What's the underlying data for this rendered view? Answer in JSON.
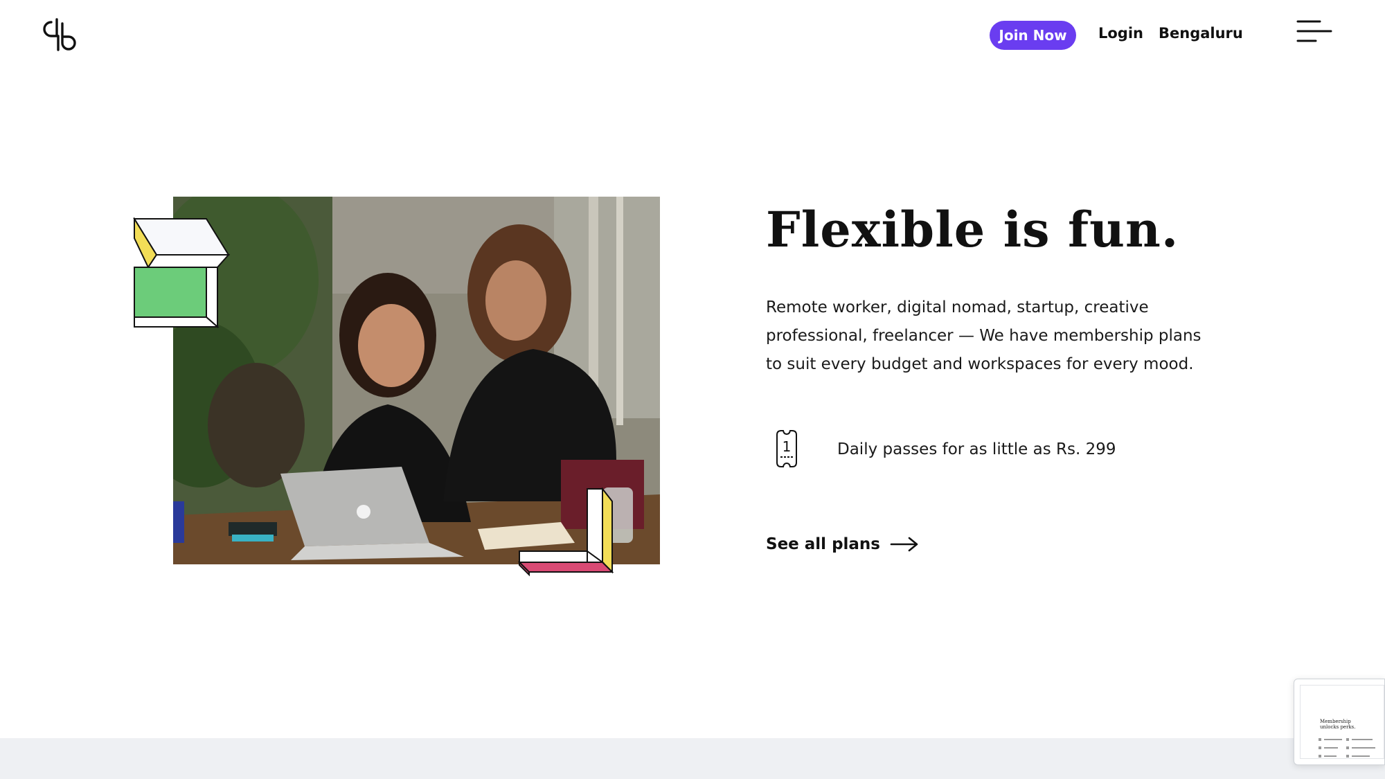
{
  "header": {
    "logo_icon": "ws-logo-icon",
    "join_label": "Join Now",
    "login_label": "Login",
    "city_label": "Bengaluru",
    "menu_icon": "hamburger-menu-icon",
    "accent_color": "#6a3df0"
  },
  "hero": {
    "headline": "Flexible is fun.",
    "description": "Remote worker, digital nomad, startup, creative professional, freelancer — We have membership plans to suit every budget and workspaces for every mood.",
    "pass_icon": "day-pass-ticket-icon",
    "pass_text": "Daily passes for as little as Rs. 299",
    "cta_label": "See all plans",
    "cta_icon": "arrow-right-icon",
    "image_alt": "two women working at a laptop"
  },
  "preview": {
    "title": "Membership unlocks perks."
  }
}
